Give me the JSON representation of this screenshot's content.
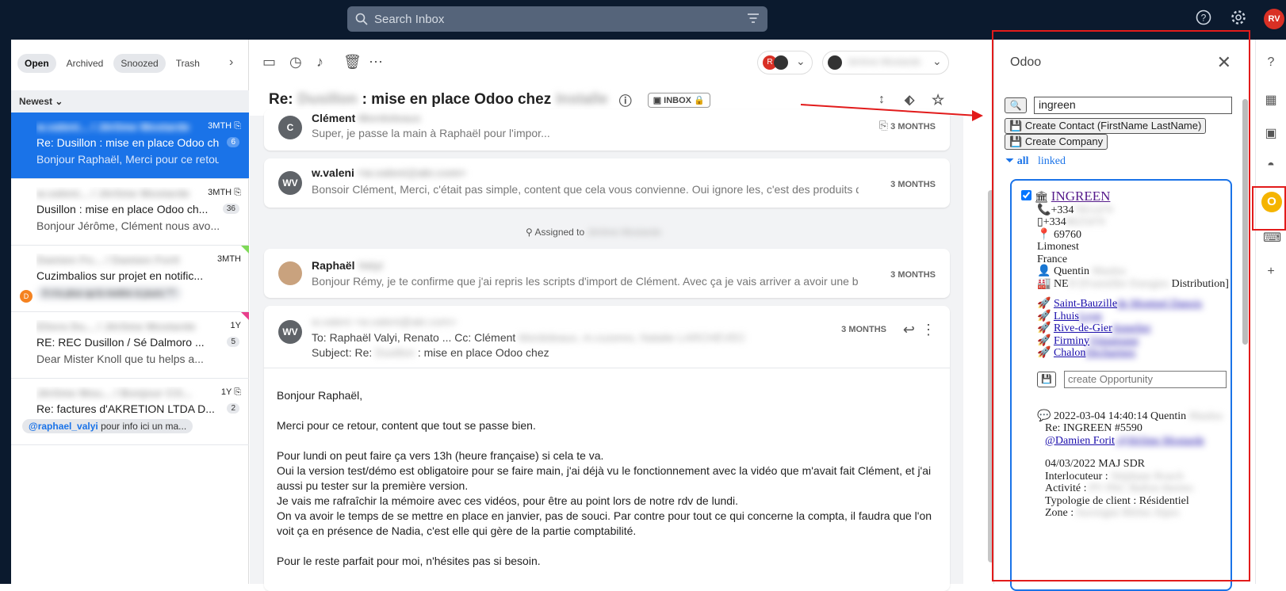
{
  "topbar": {
    "search_placeholder": "Search Inbox",
    "avatar_initials": "RV"
  },
  "folders": {
    "tabs": [
      "Open",
      "Archived",
      "Snoozed",
      "Trash"
    ],
    "sort_label": "Newest"
  },
  "mails": [
    {
      "from": "w.valeni... / Jérôme Mostarde",
      "time": "3MTH",
      "subject": "Re: Dusillon : mise en place Odoo chez",
      "preview": "Bonjour Raphaël, Merci pour ce retour...",
      "count": "6"
    },
    {
      "from": "w.valeni... / Jérôme Mostarde",
      "time": "3MTH",
      "subject": "Dusillon : mise en place Odoo ch...",
      "preview": "Bonjour Jérôme, Clément nous avo...",
      "count": "36"
    },
    {
      "from": "Damien Fo... / Damien Forit",
      "time": "3MTH",
      "subject": "Cuzimbalios sur projet en notific...",
      "chip": "Il n'a plus qu'à mettre à jours ^^",
      "avatar": "D"
    },
    {
      "from": "Eliora Du... / Jérôme Mostarde",
      "time": "1Y",
      "subject": "RE: REC Dusillon / Sé Dalmoro ...",
      "preview": "Dear Mister Knoll que tu helps a...",
      "count": "5"
    },
    {
      "from": "Jérôme Mou... / Bonjour CO...",
      "time": "1Y",
      "subject": "Re: factures d'AKRETION LTDA D...",
      "chip_mention": "@raphael_valyi",
      "chip_rest": "pour info ici un ma...",
      "count": "2"
    }
  ],
  "thread": {
    "title_prefix": "Re:",
    "title_blur1": "Dusillon",
    "title_mid": ": mise en place Odoo chez",
    "title_blur2": "Installe",
    "inbox_label": "INBOX",
    "assigned_label": "Assigned to",
    "assigned_name": "Jérôme Mostarde",
    "messages": [
      {
        "avatar": "C",
        "from": "Clément",
        "from_blur": "Mordoleaux",
        "snippet": "Super, je passe la main à Raphaël pour l'impor...",
        "when": "3 MONTHS"
      },
      {
        "avatar": "WV",
        "from": "w.valeni",
        "from_blur": "<w.valeni@akr.com>",
        "snippet": "Bonsoir Clément, Merci, c'était pas simple, content que cela vous convienne. Oui ignore les, c'est des produits qu'on ...",
        "when": "3 MONTHS"
      },
      {
        "avatar": "",
        "from": "Raphaël",
        "from_blur": "Valyi",
        "snippet": "Bonjour Rémy, je te confirme que j'ai repris les scripts d'import de Clément. Avec ça je vais arriver a avoir une base ...",
        "when": "3 MONTHS"
      }
    ],
    "open_msg": {
      "avatar": "WV",
      "from_blur": "w.valeni <w.valeni@akr.com>",
      "to": "To: Raphaël Valyi, Renato ...  Cc: Clément",
      "subject_prefix": "Subject: Re:",
      "subject_blur": "Dusillon",
      "subject_rest": ": mise en place Odoo chez",
      "when": "3 MONTHS",
      "body": [
        "Bonjour Raphaël,",
        "",
        "Merci pour ce retour, content que tout se passe bien.",
        "",
        "Pour lundi on peut faire ça vers 13h (heure française) si cela te va.",
        "Oui la version test/démo est obligatoire pour se faire main, j'ai déjà vu le fonctionnement avec la vidéo que m'avait fait Clément, et j'ai aussi pu tester sur la première version.",
        "Je vais me rafraîchir la mémoire avec ces vidéos, pour être au point lors de notre rdv de lundi.",
        "On va avoir le temps de se mettre en place en janvier, pas de souci. Par contre pour tout ce qui concerne la compta, il faudra que l'on voit ça en présence de Nadia, c'est elle qui gère de la partie comptabilité.",
        "",
        "Pour le reste parfait pour moi, n'hésites pas si besoin."
      ]
    }
  },
  "odoo": {
    "title": "Odoo",
    "search_value": "ingreen",
    "create_contact": "Create Contact (FirstName LastName)",
    "create_company": "Create Company",
    "filter_all": "all",
    "filter_linked": "linked",
    "partner": {
      "name": "INGREEN",
      "phone": "+334",
      "mobile": "+334",
      "zip": "69760",
      "city": "Limonest",
      "country": "France",
      "contact": "Quentin",
      "industry": "NE",
      "industry_end": "Distribution]",
      "opps": [
        "Saint-Bauzille",
        "Lhuis",
        "Rive-de-Gier",
        "Firminy",
        "Chalon"
      ],
      "opp_placeholder": "create Opportunity",
      "note_date": "2022-03-04 14:40:14",
      "note_author": "Quentin",
      "note_re": "Re: INGREEN #5590",
      "note_mention": "@Damien Forit",
      "note_lines": [
        "04/03/2022 MAJ SDR",
        "Interlocuteur :",
        "Activité :",
        "Typologie de client : Résidentiel",
        "Zone :"
      ]
    }
  },
  "colors": {
    "accent": "#1a73e8",
    "topbar": "#0b1a2e",
    "annotation": "#e21b1b",
    "odoo": "#f5b400"
  }
}
